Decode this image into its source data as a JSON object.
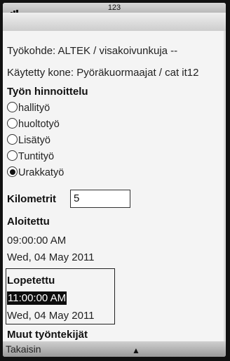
{
  "status": {
    "time": "123"
  },
  "work_site": "Työkohde: ALTEK / visakoivunkuja --",
  "machine": "Käytetty kone: Pyöräkuormaajat / cat it12",
  "pricing": {
    "title": "Työn hinnoittelu",
    "options": [
      {
        "label": "hallityö",
        "checked": false
      },
      {
        "label": "huoltotyö",
        "checked": false
      },
      {
        "label": "Lisätyö",
        "checked": false
      },
      {
        "label": "Tuntityö",
        "checked": false
      },
      {
        "label": "Urakkatyö",
        "checked": true
      }
    ]
  },
  "kilometers": {
    "label": "Kilometrit",
    "value": "5"
  },
  "started": {
    "label": "Aloitettu",
    "time": "09:00:00 AM",
    "date": "Wed, 04 May 2011"
  },
  "finished": {
    "label": "Lopetettu",
    "time": "11:00:00 AM",
    "date": "Wed, 04 May 2011"
  },
  "other_workers": {
    "label": "Muut työntekijät"
  },
  "softkeys": {
    "left": "Takaisin",
    "middle": "▲"
  }
}
